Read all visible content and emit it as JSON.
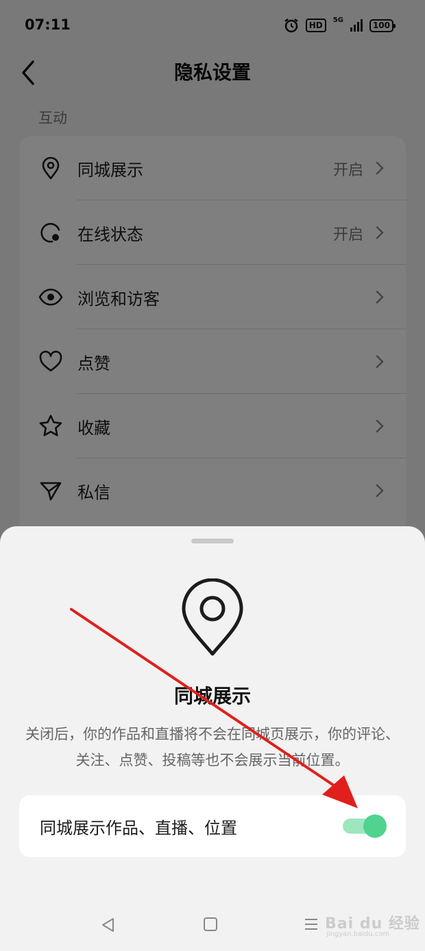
{
  "status_bar": {
    "time": "07:11",
    "hd": "HD",
    "network": "5G",
    "battery": "100"
  },
  "header": {
    "title": "隐私设置"
  },
  "section": {
    "label": "互动"
  },
  "settings": [
    {
      "label": "同城展示",
      "value": "开启",
      "icon": "location-pin-icon"
    },
    {
      "label": "在线状态",
      "value": "开启",
      "icon": "online-status-icon"
    },
    {
      "label": "浏览和访客",
      "value": "",
      "icon": "eye-icon"
    },
    {
      "label": "点赞",
      "value": "",
      "icon": "heart-icon"
    },
    {
      "label": "收藏",
      "value": "",
      "icon": "star-icon"
    },
    {
      "label": "私信",
      "value": "",
      "icon": "send-icon"
    }
  ],
  "sheet": {
    "title": "同城展示",
    "description": "关闭后，你的作品和直播将不会在同城页展示，你的评论、关注、点赞、投稿等也不会展示当前位置。",
    "toggle_label": "同城展示作品、直播、位置",
    "toggle_on": true,
    "accent_color": "#4fd38e"
  },
  "watermark": {
    "brand": "Bai du 经验",
    "url": "jingyan.baidu.com"
  },
  "annotation": {
    "arrow_color": "#e0201c"
  }
}
